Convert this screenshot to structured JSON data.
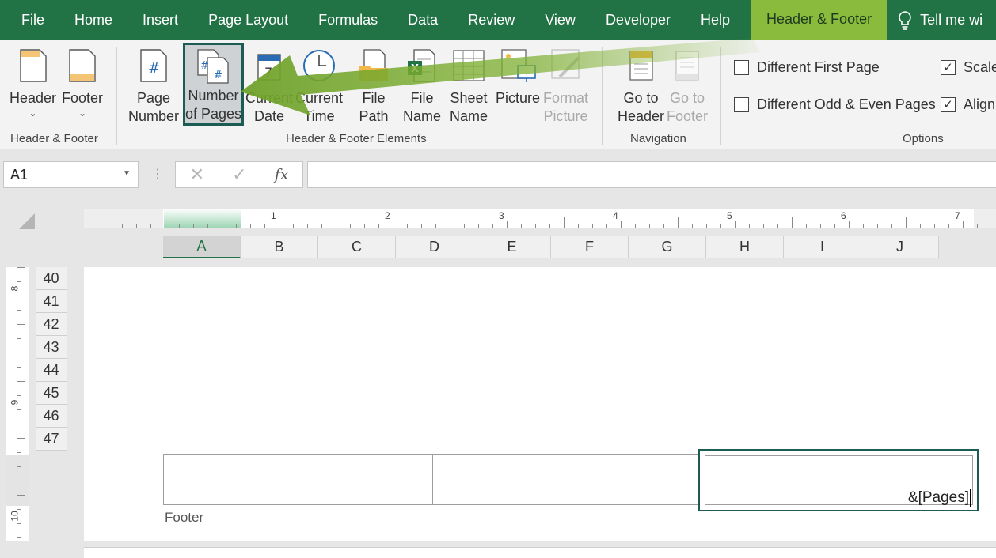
{
  "menu": {
    "tabs": [
      "File",
      "Home",
      "Insert",
      "Page Layout",
      "Formulas",
      "Data",
      "Review",
      "View",
      "Developer",
      "Help"
    ],
    "active_tab": "Header & Footer",
    "tell_me": "Tell me wi"
  },
  "ribbon": {
    "header_btn": "Header",
    "footer_btn": "Footer",
    "group_hf": "Header & Footer",
    "page_number_1": "Page",
    "page_number_2": "Number",
    "num_pages_1": "Number",
    "num_pages_2": "of Pages",
    "current_date_1": "Current",
    "current_date_2": "Date",
    "current_time_1": "Current",
    "current_time_2": "Time",
    "file_path_1": "File",
    "file_path_2": "Path",
    "file_name_1": "File",
    "file_name_2": "Name",
    "sheet_name_1": "Sheet",
    "sheet_name_2": "Name",
    "picture": "Picture",
    "format_picture_1": "Format",
    "format_picture_2": "Picture",
    "group_elements": "Header & Footer Elements",
    "goto_header_1": "Go to",
    "goto_header_2": "Header",
    "goto_footer_1": "Go to",
    "goto_footer_2": "Footer",
    "group_nav": "Navigation",
    "opt_first_page": "Different First Page",
    "opt_odd_even": "Different Odd & Even Pages",
    "opt_scale": "Scale",
    "opt_align": "Align",
    "group_options": "Options",
    "check_mark": "✓"
  },
  "formula_bar": {
    "name_box": "A1",
    "cancel": "✕",
    "enter": "✓",
    "fx": "fx",
    "content": ""
  },
  "ruler": {
    "h_numbers": [
      "1",
      "2",
      "3",
      "4",
      "5",
      "6",
      "7"
    ],
    "v_numbers": [
      "8",
      "9",
      "10"
    ]
  },
  "columns": [
    "A",
    "B",
    "C",
    "D",
    "E",
    "F",
    "G",
    "H",
    "I",
    "J"
  ],
  "rows": [
    "40",
    "41",
    "42",
    "43",
    "44",
    "45",
    "46",
    "47"
  ],
  "footer": {
    "label": "Footer",
    "right_code": "&[Pages]"
  },
  "colors": {
    "menu_green": "#217346",
    "active_tab": "#8bbb3d",
    "highlight_border": "#1c5c52",
    "arrow": "#7fb032"
  }
}
